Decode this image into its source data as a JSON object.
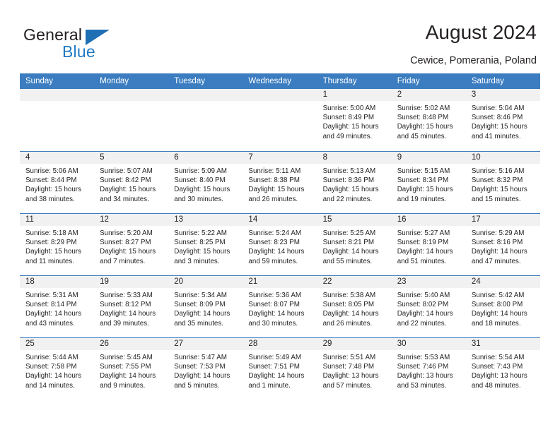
{
  "brand": {
    "name_top": "General",
    "name_bottom": "Blue",
    "triangle_color": "#1f6fb5",
    "blue_color": "#1f7ac4"
  },
  "header": {
    "title": "August 2024",
    "subtitle": "Cewice, Pomerania, Poland"
  },
  "theme": {
    "header_blue": "#3b7dc0",
    "day_band": "#f1f1f1",
    "text": "#231f20"
  },
  "weekdays": [
    "Sunday",
    "Monday",
    "Tuesday",
    "Wednesday",
    "Thursday",
    "Friday",
    "Saturday"
  ],
  "weeks": [
    [
      {
        "day": "",
        "sunrise": "",
        "sunset": "",
        "daylight": "",
        "empty": true
      },
      {
        "day": "",
        "sunrise": "",
        "sunset": "",
        "daylight": "",
        "empty": true
      },
      {
        "day": "",
        "sunrise": "",
        "sunset": "",
        "daylight": "",
        "empty": true
      },
      {
        "day": "",
        "sunrise": "",
        "sunset": "",
        "daylight": "",
        "empty": true
      },
      {
        "day": "1",
        "sunrise": "Sunrise: 5:00 AM",
        "sunset": "Sunset: 8:49 PM",
        "daylight": "Daylight: 15 hours and 49 minutes."
      },
      {
        "day": "2",
        "sunrise": "Sunrise: 5:02 AM",
        "sunset": "Sunset: 8:48 PM",
        "daylight": "Daylight: 15 hours and 45 minutes."
      },
      {
        "day": "3",
        "sunrise": "Sunrise: 5:04 AM",
        "sunset": "Sunset: 8:46 PM",
        "daylight": "Daylight: 15 hours and 41 minutes."
      }
    ],
    [
      {
        "day": "4",
        "sunrise": "Sunrise: 5:06 AM",
        "sunset": "Sunset: 8:44 PM",
        "daylight": "Daylight: 15 hours and 38 minutes."
      },
      {
        "day": "5",
        "sunrise": "Sunrise: 5:07 AM",
        "sunset": "Sunset: 8:42 PM",
        "daylight": "Daylight: 15 hours and 34 minutes."
      },
      {
        "day": "6",
        "sunrise": "Sunrise: 5:09 AM",
        "sunset": "Sunset: 8:40 PM",
        "daylight": "Daylight: 15 hours and 30 minutes."
      },
      {
        "day": "7",
        "sunrise": "Sunrise: 5:11 AM",
        "sunset": "Sunset: 8:38 PM",
        "daylight": "Daylight: 15 hours and 26 minutes."
      },
      {
        "day": "8",
        "sunrise": "Sunrise: 5:13 AM",
        "sunset": "Sunset: 8:36 PM",
        "daylight": "Daylight: 15 hours and 22 minutes."
      },
      {
        "day": "9",
        "sunrise": "Sunrise: 5:15 AM",
        "sunset": "Sunset: 8:34 PM",
        "daylight": "Daylight: 15 hours and 19 minutes."
      },
      {
        "day": "10",
        "sunrise": "Sunrise: 5:16 AM",
        "sunset": "Sunset: 8:32 PM",
        "daylight": "Daylight: 15 hours and 15 minutes."
      }
    ],
    [
      {
        "day": "11",
        "sunrise": "Sunrise: 5:18 AM",
        "sunset": "Sunset: 8:29 PM",
        "daylight": "Daylight: 15 hours and 11 minutes."
      },
      {
        "day": "12",
        "sunrise": "Sunrise: 5:20 AM",
        "sunset": "Sunset: 8:27 PM",
        "daylight": "Daylight: 15 hours and 7 minutes."
      },
      {
        "day": "13",
        "sunrise": "Sunrise: 5:22 AM",
        "sunset": "Sunset: 8:25 PM",
        "daylight": "Daylight: 15 hours and 3 minutes."
      },
      {
        "day": "14",
        "sunrise": "Sunrise: 5:24 AM",
        "sunset": "Sunset: 8:23 PM",
        "daylight": "Daylight: 14 hours and 59 minutes."
      },
      {
        "day": "15",
        "sunrise": "Sunrise: 5:25 AM",
        "sunset": "Sunset: 8:21 PM",
        "daylight": "Daylight: 14 hours and 55 minutes."
      },
      {
        "day": "16",
        "sunrise": "Sunrise: 5:27 AM",
        "sunset": "Sunset: 8:19 PM",
        "daylight": "Daylight: 14 hours and 51 minutes."
      },
      {
        "day": "17",
        "sunrise": "Sunrise: 5:29 AM",
        "sunset": "Sunset: 8:16 PM",
        "daylight": "Daylight: 14 hours and 47 minutes."
      }
    ],
    [
      {
        "day": "18",
        "sunrise": "Sunrise: 5:31 AM",
        "sunset": "Sunset: 8:14 PM",
        "daylight": "Daylight: 14 hours and 43 minutes."
      },
      {
        "day": "19",
        "sunrise": "Sunrise: 5:33 AM",
        "sunset": "Sunset: 8:12 PM",
        "daylight": "Daylight: 14 hours and 39 minutes."
      },
      {
        "day": "20",
        "sunrise": "Sunrise: 5:34 AM",
        "sunset": "Sunset: 8:09 PM",
        "daylight": "Daylight: 14 hours and 35 minutes."
      },
      {
        "day": "21",
        "sunrise": "Sunrise: 5:36 AM",
        "sunset": "Sunset: 8:07 PM",
        "daylight": "Daylight: 14 hours and 30 minutes."
      },
      {
        "day": "22",
        "sunrise": "Sunrise: 5:38 AM",
        "sunset": "Sunset: 8:05 PM",
        "daylight": "Daylight: 14 hours and 26 minutes."
      },
      {
        "day": "23",
        "sunrise": "Sunrise: 5:40 AM",
        "sunset": "Sunset: 8:02 PM",
        "daylight": "Daylight: 14 hours and 22 minutes."
      },
      {
        "day": "24",
        "sunrise": "Sunrise: 5:42 AM",
        "sunset": "Sunset: 8:00 PM",
        "daylight": "Daylight: 14 hours and 18 minutes."
      }
    ],
    [
      {
        "day": "25",
        "sunrise": "Sunrise: 5:44 AM",
        "sunset": "Sunset: 7:58 PM",
        "daylight": "Daylight: 14 hours and 14 minutes."
      },
      {
        "day": "26",
        "sunrise": "Sunrise: 5:45 AM",
        "sunset": "Sunset: 7:55 PM",
        "daylight": "Daylight: 14 hours and 9 minutes."
      },
      {
        "day": "27",
        "sunrise": "Sunrise: 5:47 AM",
        "sunset": "Sunset: 7:53 PM",
        "daylight": "Daylight: 14 hours and 5 minutes."
      },
      {
        "day": "28",
        "sunrise": "Sunrise: 5:49 AM",
        "sunset": "Sunset: 7:51 PM",
        "daylight": "Daylight: 14 hours and 1 minute."
      },
      {
        "day": "29",
        "sunrise": "Sunrise: 5:51 AM",
        "sunset": "Sunset: 7:48 PM",
        "daylight": "Daylight: 13 hours and 57 minutes."
      },
      {
        "day": "30",
        "sunrise": "Sunrise: 5:53 AM",
        "sunset": "Sunset: 7:46 PM",
        "daylight": "Daylight: 13 hours and 53 minutes."
      },
      {
        "day": "31",
        "sunrise": "Sunrise: 5:54 AM",
        "sunset": "Sunset: 7:43 PM",
        "daylight": "Daylight: 13 hours and 48 minutes."
      }
    ]
  ]
}
